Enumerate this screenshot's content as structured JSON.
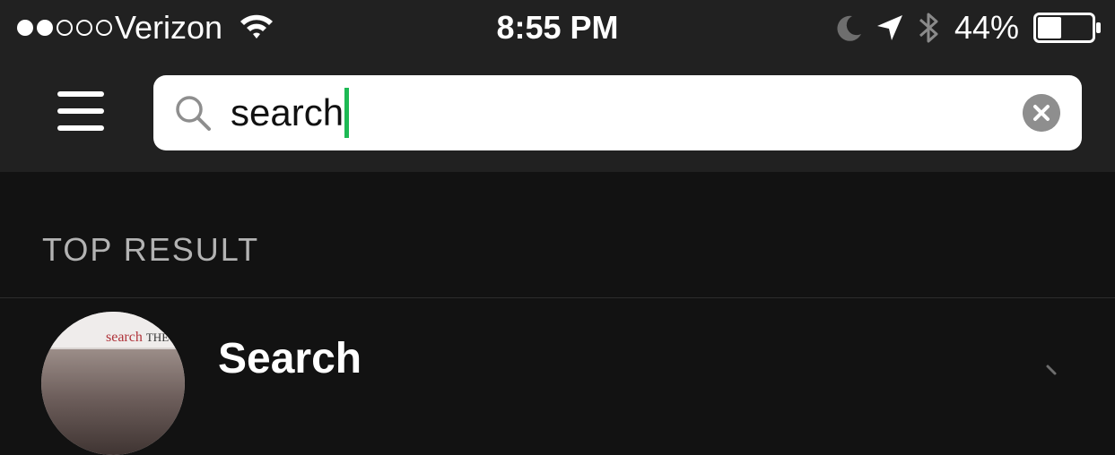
{
  "status_bar": {
    "signal_filled": 2,
    "signal_total": 5,
    "carrier": "Verizon",
    "time": "8:55 PM",
    "battery_percent": "44%",
    "battery_level": 0.44,
    "icons": [
      "wifi-icon",
      "moon-icon",
      "location-arrow-icon",
      "bluetooth-icon",
      "battery-icon"
    ]
  },
  "search": {
    "value": "search",
    "icons": [
      "menu-icon",
      "search-icon",
      "clear-icon"
    ]
  },
  "results": {
    "section_label": "TOP RESULT",
    "top_result": {
      "title": "Search",
      "art_text": "search",
      "art_band": "THE BE"
    }
  },
  "colors": {
    "header_bg": "#212121",
    "body_bg": "#121212",
    "accent": "#1db954",
    "section_label": "#b3b3b3"
  }
}
